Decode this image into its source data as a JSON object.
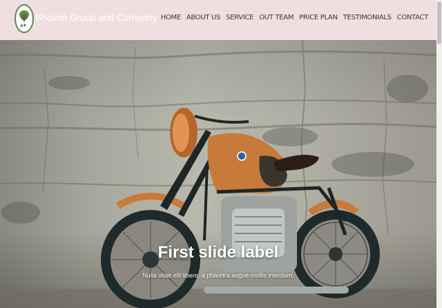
{
  "header": {
    "brand": "Shovon Group and Company",
    "nav": [
      "HOME",
      "ABOUT US",
      "SERVICE",
      "OUT TEAM",
      "PRICE PLAN",
      "TESTIMONIALS",
      "CONTACT"
    ]
  },
  "carousel": {
    "slide_title": "First slide label",
    "slide_text": "Nulla vitae elit libero, a pharetra augue mollis interdum."
  },
  "colors": {
    "navbar_bg": "#f0dfe1",
    "nav_text": "#4a3035",
    "tank_copper": "#c77a3a"
  }
}
